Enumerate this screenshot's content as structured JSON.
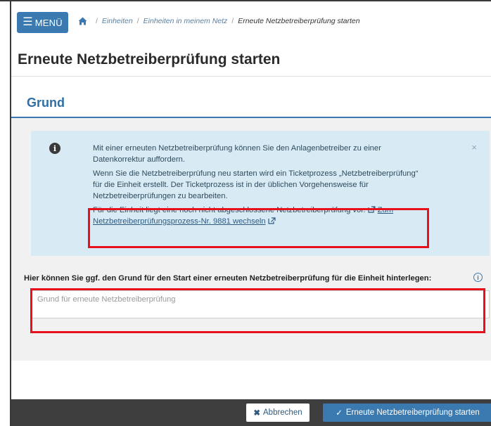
{
  "header": {
    "menu_label": "MENÜ",
    "breadcrumb": [
      "Einheiten",
      "Einheiten in meinem Netz",
      "Erneute Netzbetreiberprüfung starten"
    ]
  },
  "page": {
    "title": "Erneute Netzbetreiberprüfung starten"
  },
  "section": {
    "title": "Grund"
  },
  "info": {
    "line1": "Mit einer erneuten Netzbetreiberprüfung können Sie den Anlagenbetreiber zu einer Datenkorrektur auffordern.",
    "line2": "Wenn Sie die Netzbetreiberprüfung neu starten wird ein Ticketprozess „Netzbetreiberprüfung“ für die Einheit erstellt. Der Ticketprozess ist in der üblichen Vorgehensweise für Netzbetreiberprüfungen zu bearbeiten.",
    "line3_prefix": "Für die Einheit liegt eine noch nicht abgeschlossene Netzbetreiberprüfung vor.",
    "line3_link_a": "Zum",
    "line3_link_b": "Netzbetreiberprüfungsprozess-Nr. 9881 wechseln",
    "close": "×"
  },
  "field": {
    "label": "Hier können Sie ggf. den Grund für den Start einer erneuten Netzbetreiberprüfung für die Einheit hinterlegen:",
    "placeholder": "Grund für erneute Netzbetreiberprüfung",
    "value": ""
  },
  "footer": {
    "cancel_label": "Abbrechen",
    "start_label": "Erneute Netzbetreiberprüfung starten"
  },
  "colors": {
    "primary": "#3a7ab0",
    "info_bg": "#d8ebf5",
    "highlight": "#e8101a",
    "footer_bg": "#3e3e3e"
  },
  "icons": [
    "menu-icon",
    "home-icon",
    "info-icon",
    "close-icon",
    "external-link-icon",
    "cancel-x-icon",
    "check-icon"
  ]
}
